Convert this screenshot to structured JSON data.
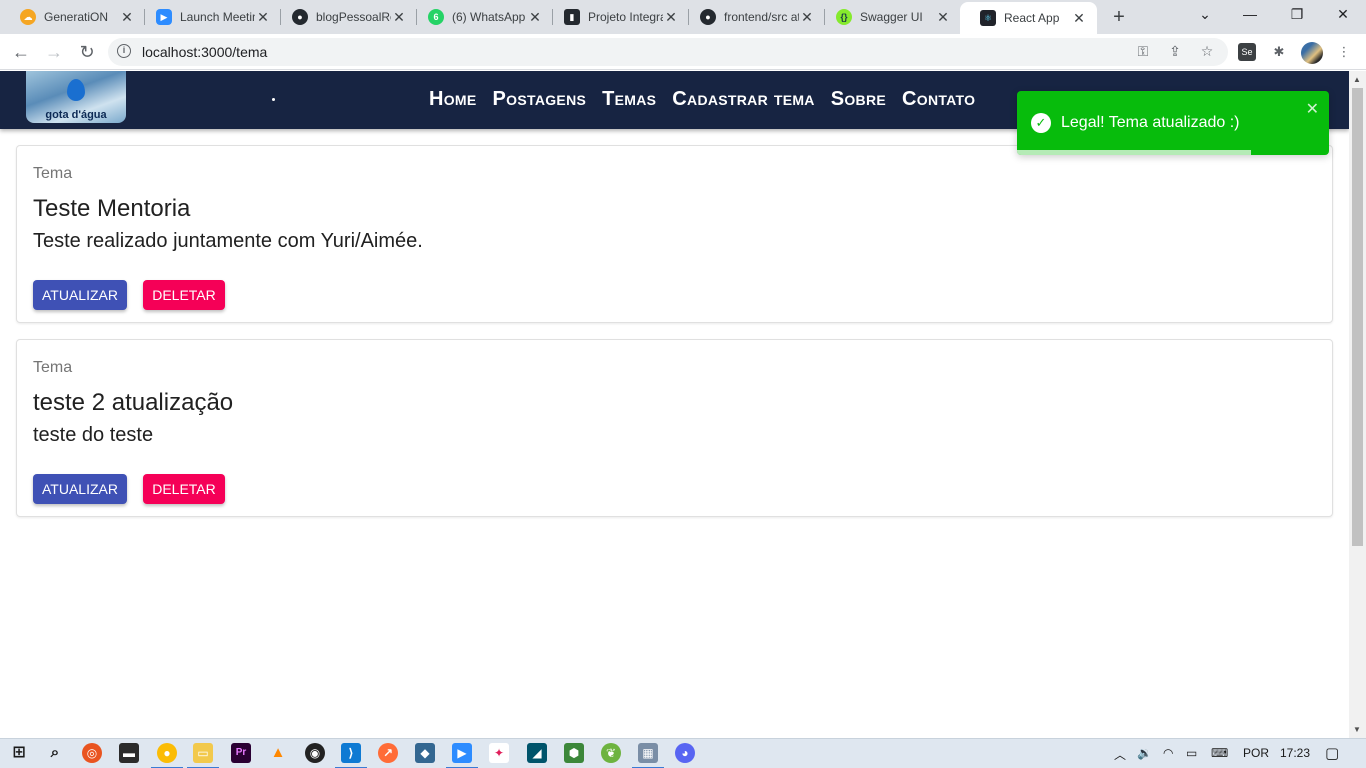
{
  "browser": {
    "tabs": [
      {
        "title": "GeneratiON",
        "favicon": "cloud-icon",
        "color": "#f5a623"
      },
      {
        "title": "Launch Meeting",
        "favicon": "zoom-icon",
        "color": "#2d8cff"
      },
      {
        "title": "blogPessoalReact",
        "favicon": "github-icon",
        "color": "#24292f"
      },
      {
        "title": "(6) WhatsApp",
        "favicon": "whatsapp-icon",
        "color": "#25d366",
        "badge": "6"
      },
      {
        "title": "Projeto Integrador",
        "favicon": "trello-icon",
        "color": "#24292f"
      },
      {
        "title": "frontend/src at main",
        "favicon": "github-icon",
        "color": "#24292f"
      },
      {
        "title": "Swagger UI",
        "favicon": "swagger-icon",
        "color": "#85ea2d"
      },
      {
        "title": "React App",
        "favicon": "react-icon",
        "color": "#61dafb",
        "active": true
      }
    ],
    "url": "localhost:3000/tema"
  },
  "app": {
    "logo_text": "gota d'água",
    "nav": [
      "Home",
      "Postagens",
      "Temas",
      "Cadastrar tema",
      "Sobre",
      "Contato"
    ],
    "cards": [
      {
        "label": "Tema",
        "title": "Teste Mentoria",
        "description": "Teste realizado juntamente com Yuri/Aimée.",
        "update": "Atualizar",
        "delete": "Deletar"
      },
      {
        "label": "Tema",
        "title": "teste 2 atualização",
        "description": "teste do teste",
        "update": "Atualizar",
        "delete": "Deletar"
      }
    ],
    "toast": {
      "message": "Legal! Tema atualizado :)",
      "progress": 0.75
    }
  },
  "taskbar": {
    "language": "POR",
    "time": "17:23"
  },
  "colors": {
    "appbar": "#172442",
    "update_button": "#3f51b5",
    "delete_button": "#f50057",
    "toast": "#07bc0c"
  }
}
